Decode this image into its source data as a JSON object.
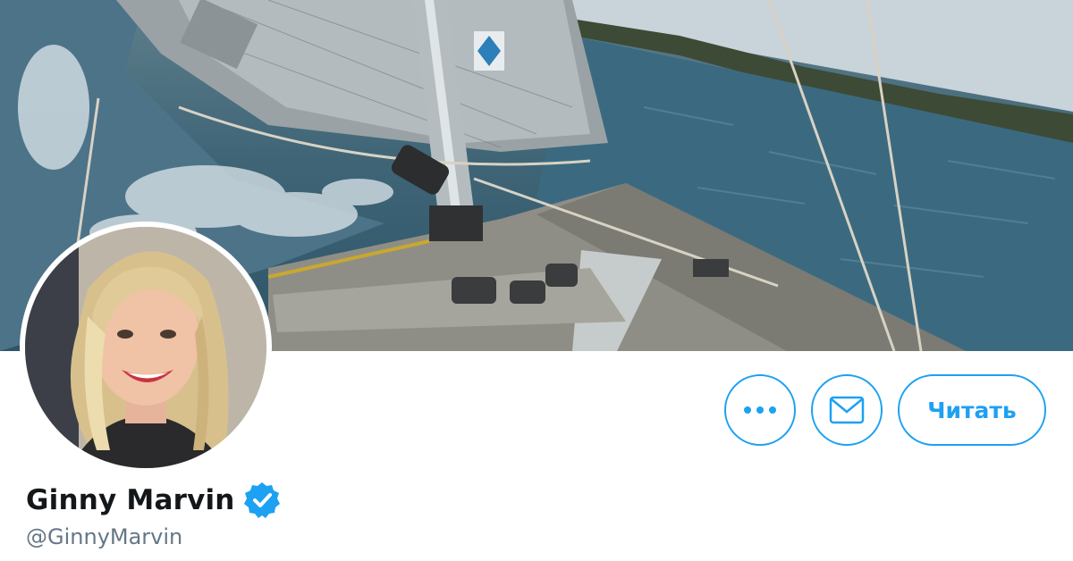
{
  "profile": {
    "display_name": "Ginny Marvin",
    "handle": "@GinnyMarvin",
    "verified": true
  },
  "banner": {
    "description_icon": "sailboat-photo"
  },
  "actions": {
    "more_icon": "more-options-icon",
    "message_icon": "mail-icon",
    "follow_label": "Читать"
  },
  "colors": {
    "accent": "#1da1f2",
    "name_text": "#14171a",
    "handle_text": "#657786"
  }
}
